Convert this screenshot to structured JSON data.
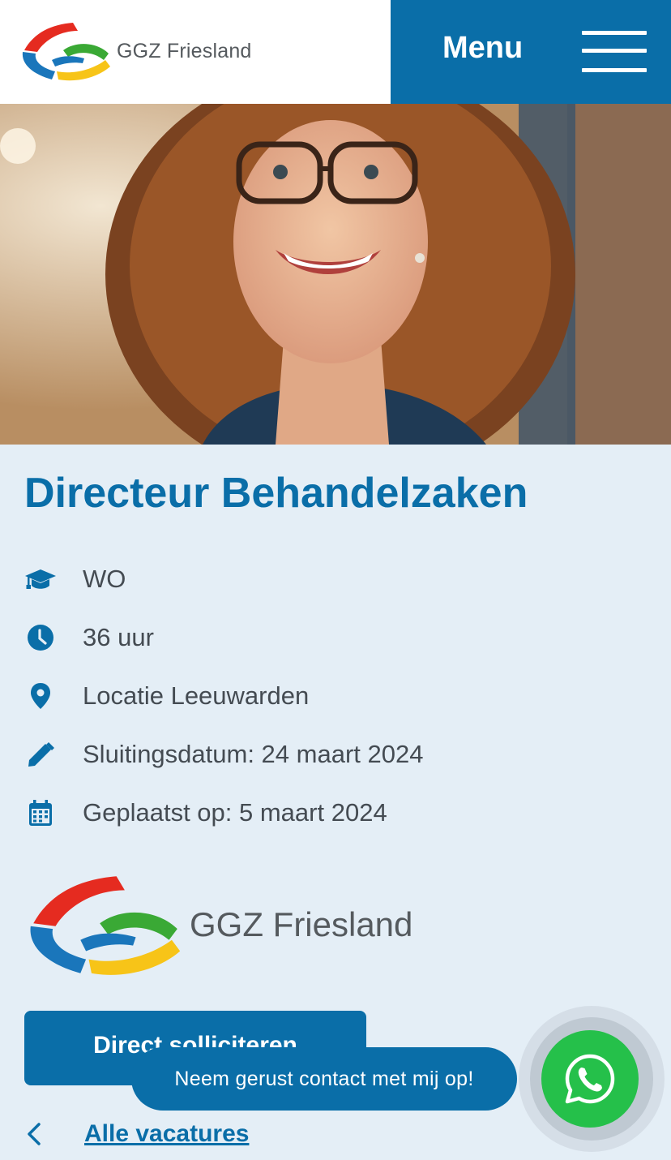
{
  "header": {
    "logo_text": "GGZ Friesland",
    "menu_label": "Menu"
  },
  "hero": {
    "alt": "Portrait of a smiling woman with curly hair and glasses"
  },
  "vacancy": {
    "title": "Directeur Behandelzaken",
    "details": [
      {
        "icon": "graduation-cap-icon",
        "text": "WO"
      },
      {
        "icon": "clock-icon",
        "text": "36 uur"
      },
      {
        "icon": "location-pin-icon",
        "text": "Locatie Leeuwarden"
      },
      {
        "icon": "pencil-icon",
        "text": "Sluitingsdatum: 24 maart 2024"
      },
      {
        "icon": "calendar-icon",
        "text": "Geplaatst op: 5 maart 2024"
      }
    ],
    "employer_logo_text": "GGZ Friesland",
    "apply_label": "Direct solliciteren",
    "back_label": "Alle vacatures"
  },
  "chat": {
    "bubble_text": "Neem gerust contact met mij op!",
    "icon": "whatsapp-icon"
  },
  "colors": {
    "brand_blue": "#0a6ea8",
    "background": "#e4eef6",
    "whatsapp_green": "#25c04a",
    "text_gray": "#444b52"
  }
}
